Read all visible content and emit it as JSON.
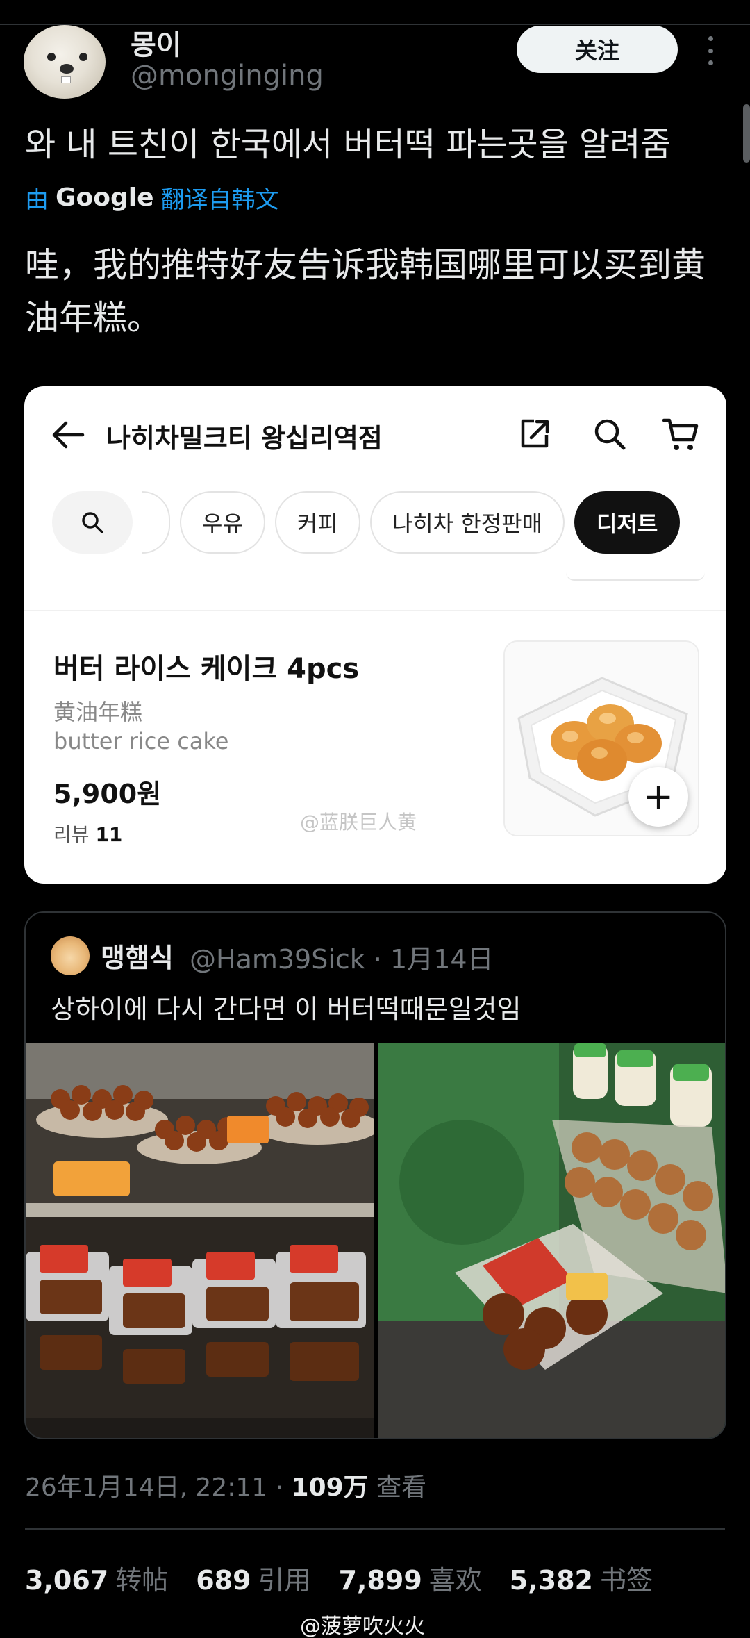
{
  "author": {
    "display_name": "몽이",
    "handle": "@monginging",
    "follow_label": "关注"
  },
  "tweet": {
    "text": "와 내 트친이 한국에서 버터떡 파는곳을 알려줌",
    "translated_by": "由",
    "translated_by_brand": "Google",
    "translated_from": "翻译自韩文",
    "translated_text": "哇，我的推特好友告诉我韩国哪里可以买到黄油年糕。"
  },
  "card": {
    "store_title": "나히차밀크티 왕십리역점",
    "chips": [
      "우유",
      "커피",
      "나히차 한정판매",
      "디저트"
    ],
    "active_chip": "디저트",
    "product": {
      "name": "버터 라이스 케이크 4pcs",
      "name_cn": "黄油年糕",
      "name_en": "butter rice cake",
      "price": "5,900원",
      "review_label": "리뷰",
      "review_count": "11"
    },
    "add_label": "+"
  },
  "watermark_top": "@蓝朕巨人黄",
  "quote": {
    "name": "맹햄식",
    "handle": "@Ham39Sick · 1月14日",
    "text": "상하이에 다시 간다면 이 버터떡때문일것임"
  },
  "meta": {
    "timestamp": "26年1月14日, 22:11 · ",
    "views_count": "109万",
    "views_label": " 查看"
  },
  "stats": [
    {
      "count": "3,067",
      "label": "转帖"
    },
    {
      "count": "689",
      "label": "引用"
    },
    {
      "count": "7,899",
      "label": "喜欢"
    },
    {
      "count": "5,382",
      "label": "书签"
    }
  ],
  "watermark_bottom": "@菠萝吹火火",
  "icons": [
    "more-icon",
    "back-arrow-icon",
    "share-icon",
    "search-icon",
    "cart-icon"
  ],
  "colors": {
    "accent": "#1d9bf0",
    "bg": "#000000",
    "muted": "#71767b"
  }
}
